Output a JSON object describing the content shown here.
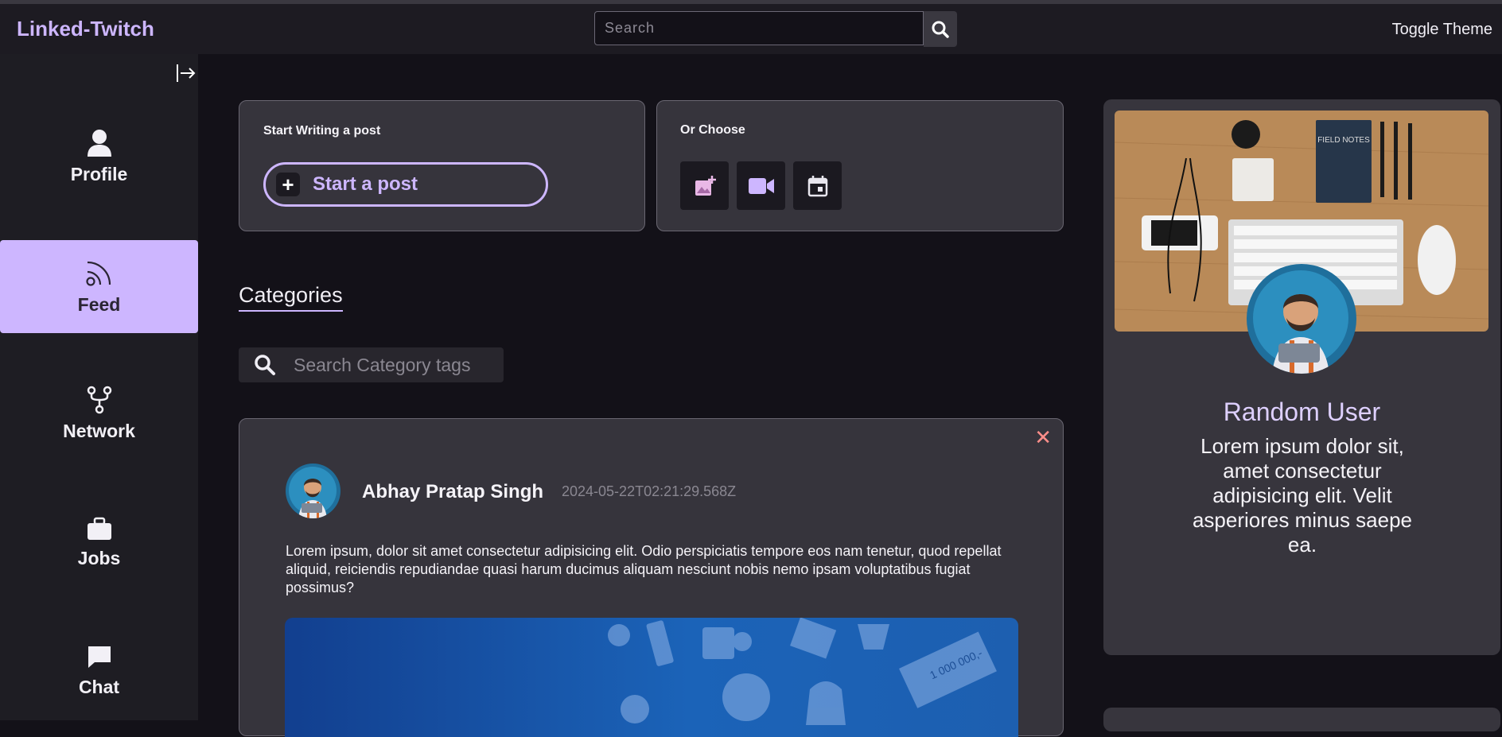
{
  "header": {
    "brand": "Linked-Twitch",
    "search_placeholder": "Search",
    "toggle_theme": "Toggle Theme"
  },
  "sidebar": {
    "items": [
      {
        "label": "Profile",
        "icon": "person-icon"
      },
      {
        "label": "Feed",
        "icon": "rss-icon",
        "active": true
      },
      {
        "label": "Network",
        "icon": "network-icon"
      },
      {
        "label": "Jobs",
        "icon": "briefcase-icon"
      },
      {
        "label": "Chat",
        "icon": "chat-bubble-icon"
      }
    ]
  },
  "composer": {
    "title": "Start Writing a post",
    "button": "Start a post"
  },
  "choose": {
    "title": "Or Choose",
    "options": [
      "add-photo-icon",
      "video-icon",
      "calendar-icon"
    ]
  },
  "categories": {
    "heading": "Categories",
    "search_placeholder": "Search Category tags"
  },
  "post": {
    "author": "Abhay Pratap Singh",
    "timestamp": "2024-05-22T02:21:29.568Z",
    "text": "Lorem ipsum, dolor sit amet consectetur adipisicing elit. Odio perspiciatis tempore eos nam tenetur, quod repellat aliquid, reiciendis repudiandae quasi harum ducimus aliquam nesciunt nobis nemo ipsam voluptatibus fugiat possimus?",
    "image_text": "1 000 000,-"
  },
  "profile_card": {
    "name": "Random User",
    "bio": "Lorem ipsum dolor sit, amet consectetur adipisicing elit. Velit asperiores minus saepe ea.",
    "cover_text": "FIELD NOTES"
  },
  "colors": {
    "accent": "#cdb6ff",
    "background": "#131118",
    "card": "#36343c",
    "sidebar": "#1e1d23",
    "close": "#ff8e8a"
  }
}
